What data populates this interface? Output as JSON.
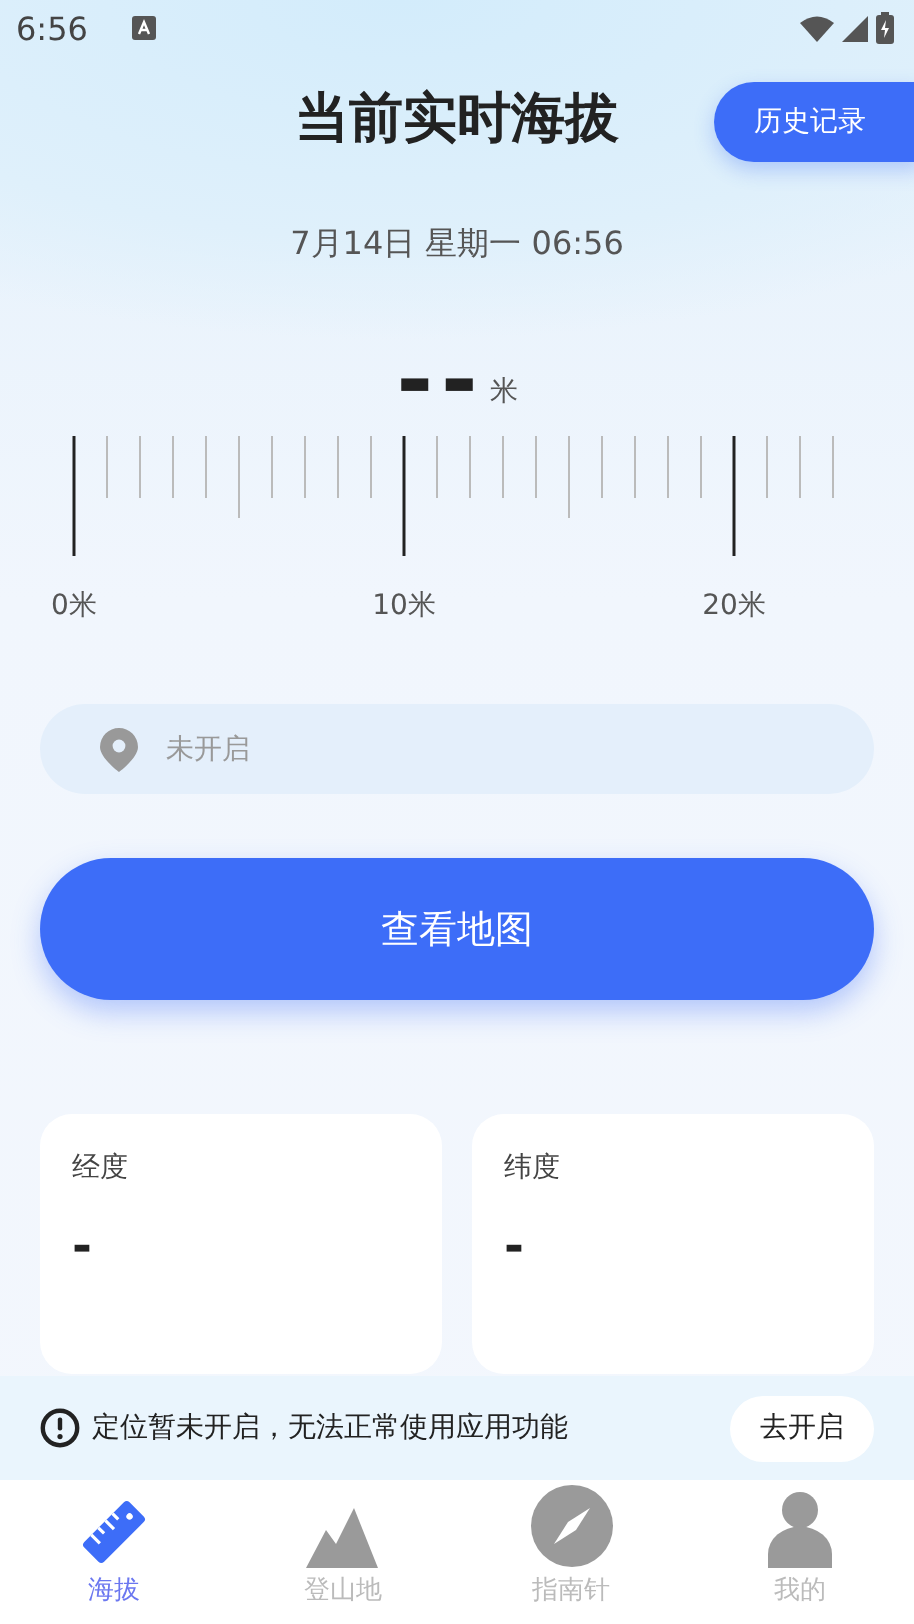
{
  "status_bar": {
    "time": "6:56"
  },
  "header": {
    "title": "当前实时海拔",
    "history_button": "历史记录",
    "date": "7月14日 星期一 06:56"
  },
  "altitude": {
    "value": "--",
    "unit": "米"
  },
  "ruler": {
    "labels": [
      "0米",
      "10米",
      "20米"
    ]
  },
  "location_field": {
    "placeholder": "未开启"
  },
  "map_button": "查看地图",
  "cards": [
    {
      "label": "经度",
      "value": "-"
    },
    {
      "label": "纬度",
      "value": "-"
    }
  ],
  "banner": {
    "message": "定位暂未开启，无法正常使用应用功能",
    "action": "去开启"
  },
  "tabs": [
    {
      "label": "海拔",
      "kind": "ruler",
      "selected": true
    },
    {
      "label": "登山地",
      "kind": "mountain",
      "selected": false
    },
    {
      "label": "指南针",
      "kind": "compass",
      "selected": false
    },
    {
      "label": "我的",
      "kind": "person",
      "selected": false
    }
  ]
}
